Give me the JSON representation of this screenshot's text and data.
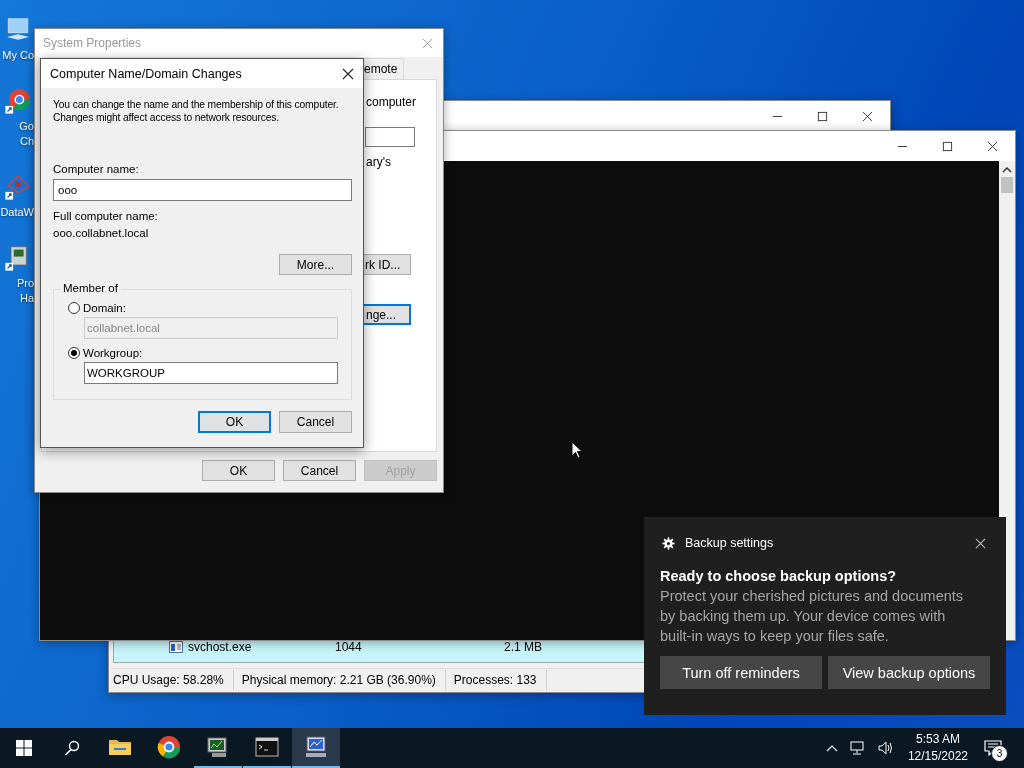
{
  "desktop_icons": [
    {
      "kind": "computer",
      "label_lines": [
        "My Co"
      ]
    },
    {
      "kind": "browser",
      "label_lines": [
        "Go",
        "Ch"
      ]
    },
    {
      "kind": "chart",
      "label_lines": [
        "DataW"
      ]
    },
    {
      "kind": "machine",
      "label_lines": [
        "Pro",
        "Ha"
      ]
    }
  ],
  "task_manager": {
    "rows": [
      {
        "name": "svchost.exe",
        "pid": "1044",
        "memory": "2.1 MB"
      }
    ],
    "status_bar": [
      "CPU Usage: 58.28%",
      "Physical memory: 2.21 GB (36.90%)",
      "Processes: 133"
    ]
  },
  "system_properties": {
    "title": "System Properties",
    "tab_label": "emote",
    "texts": [
      "computer",
      "ary's"
    ],
    "buttons": [
      {
        "label": "rk ID...",
        "focused": false
      },
      {
        "label": "nge...",
        "focused": true
      }
    ],
    "footer_buttons": [
      {
        "label": "OK",
        "disabled": false
      },
      {
        "label": "Cancel",
        "disabled": false
      },
      {
        "label": "Apply",
        "disabled": true
      }
    ]
  },
  "dialog": {
    "title": "Computer Name/Domain Changes",
    "description": "You can change the name and the membership of this computer. Changes might affect access to network resources.",
    "computer_name_label": "Computer name:",
    "computer_name": "ooo",
    "full_name_label": "Full computer name:",
    "full_name": "ooo.collabnet.local",
    "more_button": "More...",
    "member_of": {
      "legend": "Member of",
      "options": [
        {
          "label": "Domain:",
          "selected": false,
          "value": "collabnet.local"
        },
        {
          "label": "Workgroup:",
          "selected": true,
          "value": "WORKGROUP"
        }
      ]
    },
    "buttons": [
      {
        "label": "OK",
        "default": true
      },
      {
        "label": "Cancel",
        "default": false
      }
    ]
  },
  "notification": {
    "app": "Backup settings",
    "title": "Ready to choose backup options?",
    "body": "Protect your cherished pictures and documents by backing them up. Your device comes with built-in ways to keep your files safe.",
    "buttons": [
      "Turn off reminders",
      "View backup options"
    ]
  },
  "taskbar": {
    "apps": [
      {
        "kind": "folder",
        "running": false,
        "active": false
      },
      {
        "kind": "browser",
        "running": false,
        "active": false
      },
      {
        "kind": "monitor",
        "running": true,
        "active": false
      },
      {
        "kind": "console",
        "running": true,
        "active": false
      },
      {
        "kind": "system",
        "running": true,
        "active": true
      }
    ],
    "time": "5:53 AM",
    "date": "12/15/2022",
    "notification_count": "3"
  }
}
